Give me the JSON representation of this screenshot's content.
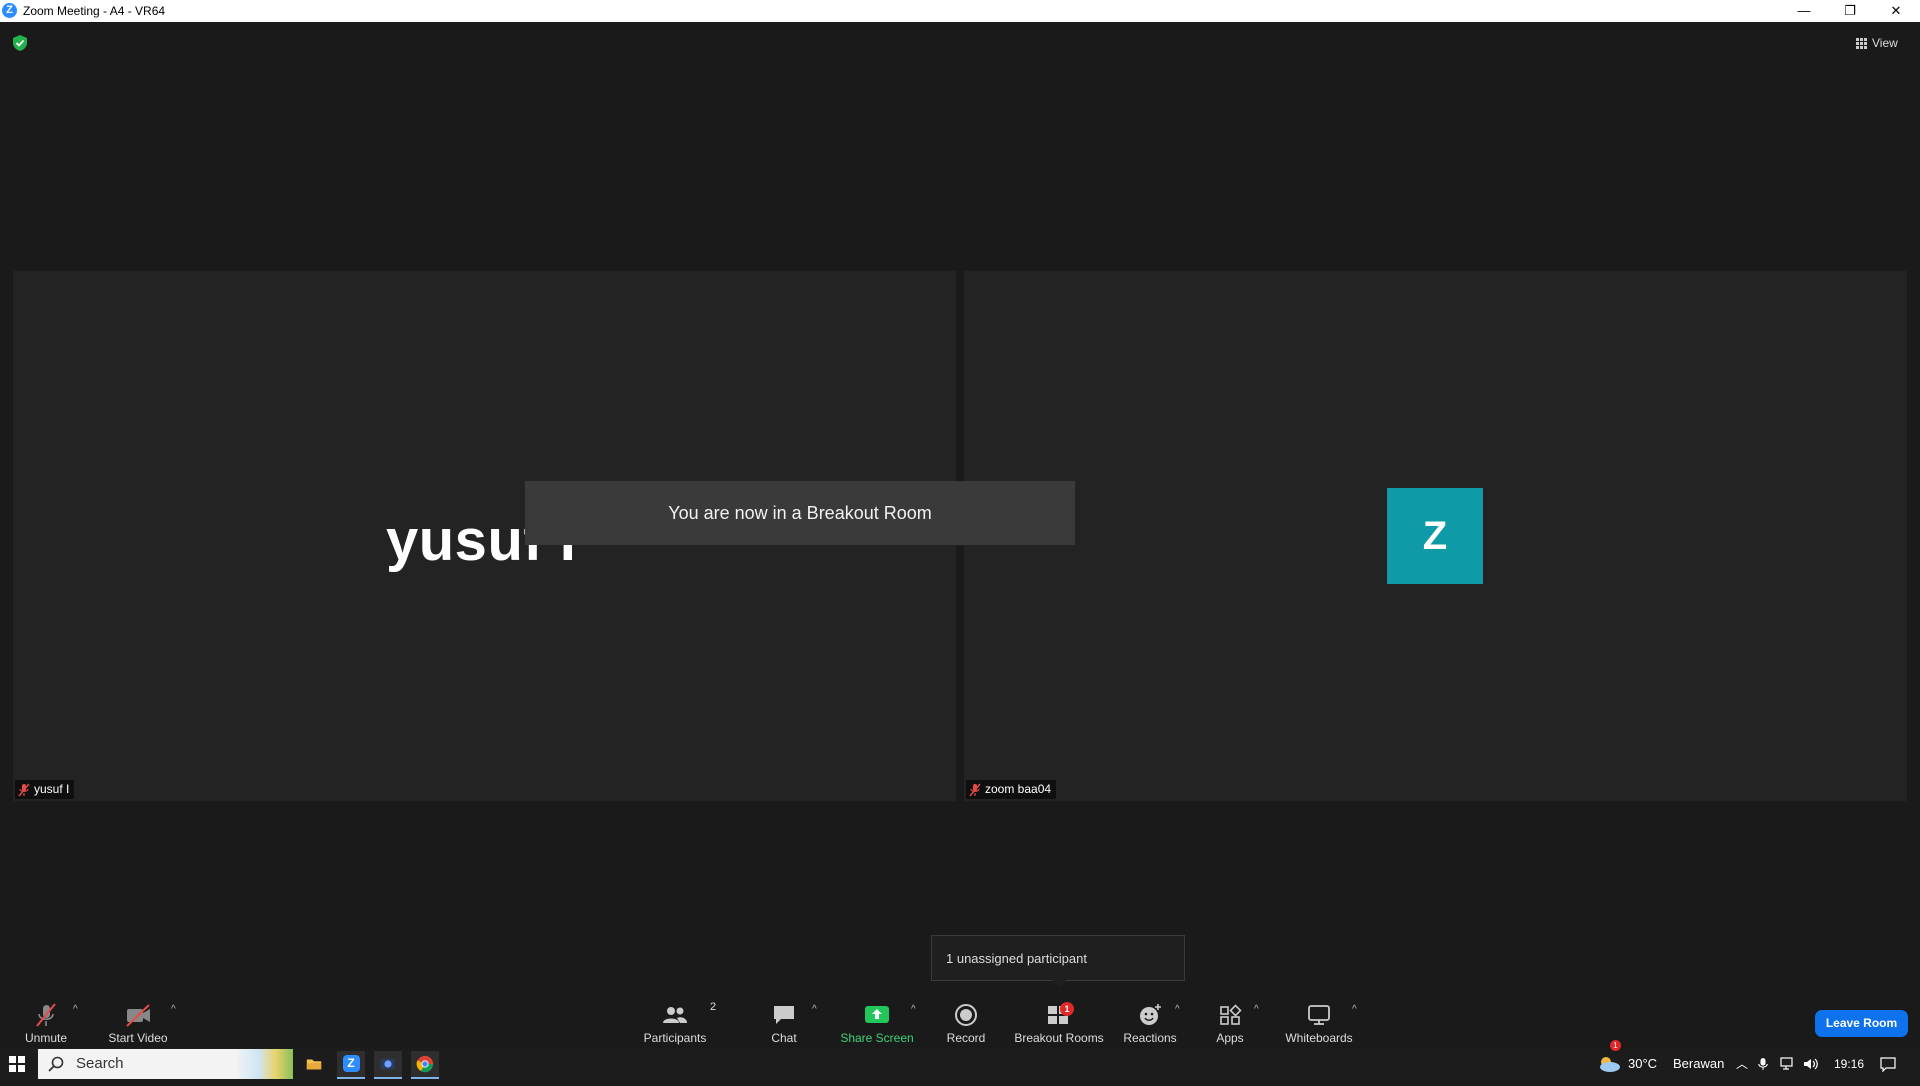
{
  "window": {
    "title": "Zoom Meeting - A4 - VR64",
    "minimize": "—",
    "restore": "❐",
    "close": "✕"
  },
  "top": {
    "view_label": "View"
  },
  "tiles": [
    {
      "big_name": "yusuf I",
      "name_tag": "yusuf I"
    },
    {
      "avatar_letter": "Z",
      "name_tag": "zoom baa04"
    }
  ],
  "notice": "You are now in a Breakout Room",
  "tooltip": "1 unassigned participant",
  "toolbar": {
    "unmute": "Unmute",
    "start_video": "Start Video",
    "participants": "Participants",
    "participants_count": "2",
    "chat": "Chat",
    "share_screen": "Share Screen",
    "record": "Record",
    "breakout_rooms": "Breakout Rooms",
    "breakout_badge": "1",
    "reactions": "Reactions",
    "apps": "Apps",
    "whiteboards": "Whiteboards",
    "leave_room": "Leave Room",
    "caret": "^"
  },
  "taskbar": {
    "search_placeholder": "Search",
    "weather_temp": "30°C",
    "weather_text": "Berawan",
    "weather_badge": "1",
    "time": "19:16"
  },
  "colors": {
    "accent_blue": "#0e72ed",
    "avatar_teal": "#0e9aa7",
    "share_green": "#3fd37a",
    "badge_red": "#e02828"
  }
}
